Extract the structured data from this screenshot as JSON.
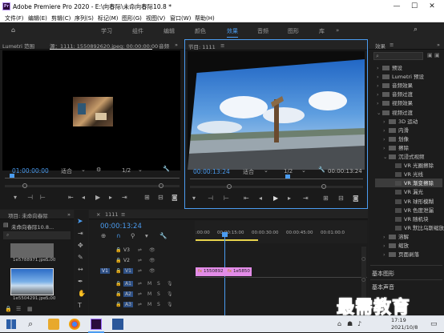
{
  "window": {
    "title": "Adobe Premiere Pro 2020 - E:\\向春际\\未命向春际10.8 *",
    "app_badge": "Pr",
    "minimize": "—",
    "maximize": "☐",
    "close": "✕"
  },
  "menu": [
    "文件(F)",
    "编辑(E)",
    "剪辑(C)",
    "序列(S)",
    "标记(M)",
    "图形(G)",
    "视图(V)",
    "窗口(W)",
    "帮助(H)"
  ],
  "workspaces": [
    "学习",
    "组件",
    "编辑",
    "颜色",
    "效果",
    "音频",
    "图形",
    "库"
  ],
  "active_workspace": "效果",
  "workspaces_more": "»",
  "source_monitor": {
    "tab_lumetri": "Lumetri 范围",
    "tab_source": "源：1111: 1550892620.jpeg: 00:00:00:00",
    "tab_audio": "音频",
    "more": "»",
    "timecode": "01:00:00:00",
    "fit": "适合",
    "resolution": "1/2"
  },
  "program_monitor": {
    "tab": "节目: 1111",
    "menu_icon": "≡",
    "timecode": "00:00:13:24",
    "fit": "适合",
    "resolution": "1/2",
    "duration": "00:00:13:24"
  },
  "effects_panel": {
    "tab": "效果",
    "menu_icon": "≡",
    "more": "»",
    "items": [
      {
        "label": "预设",
        "level": 0,
        "arrow": "›"
      },
      {
        "label": "Lumetri 预设",
        "level": 0,
        "arrow": "›"
      },
      {
        "label": "音频效果",
        "level": 0,
        "arrow": "›"
      },
      {
        "label": "音频过渡",
        "level": 0,
        "arrow": "›"
      },
      {
        "label": "视频效果",
        "level": 0,
        "arrow": "›"
      },
      {
        "label": "视频过渡",
        "level": 0,
        "arrow": "⌄"
      },
      {
        "label": "3D 运动",
        "level": 1,
        "arrow": "›"
      },
      {
        "label": "内滑",
        "level": 1,
        "arrow": "›"
      },
      {
        "label": "划像",
        "level": 1,
        "arrow": "›"
      },
      {
        "label": "擦除",
        "level": 1,
        "arrow": "›"
      },
      {
        "label": "沉浸式视频",
        "level": 1,
        "arrow": "⌄"
      },
      {
        "label": "VR 光圈擦除",
        "level": 2,
        "arrow": ""
      },
      {
        "label": "VR 光线",
        "level": 2,
        "arrow": ""
      },
      {
        "label": "VR 渐变擦除",
        "level": 2,
        "arrow": "",
        "selected": true
      },
      {
        "label": "VR 漏光",
        "level": 2,
        "arrow": ""
      },
      {
        "label": "VR 球形模糊",
        "level": 2,
        "arrow": ""
      },
      {
        "label": "VR 色度泄漏",
        "level": 2,
        "arrow": ""
      },
      {
        "label": "VR 随机块",
        "level": 2,
        "arrow": ""
      },
      {
        "label": "VR 默比乌斯缩放",
        "level": 2,
        "arrow": ""
      },
      {
        "label": "溶解",
        "level": 1,
        "arrow": "›"
      },
      {
        "label": "缩放",
        "level": 1,
        "arrow": "›"
      },
      {
        "label": "页面剥落",
        "level": 1,
        "arrow": "›"
      }
    ]
  },
  "basic_graphics": "基本图形",
  "basic_sound": "基本声音",
  "project_panel": {
    "tab": "项目: 未命向春际",
    "more": "»",
    "item_name": "未命向春际10.8...",
    "clips": [
      {
        "name": "1e5788971.jpe...",
        "duration": "5:00"
      },
      {
        "name": "1e5504291.jpe...",
        "duration": "5:00"
      }
    ]
  },
  "timeline": {
    "tab": "1111",
    "close": "×",
    "menu_icon": "≡",
    "timecode": "00:00:13:24",
    "ruler": [
      ":00:00",
      "00:00:15:00",
      "00:00:30:00",
      "00:00:45:00",
      "00:01:00:0"
    ],
    "tracks": [
      {
        "label": "V3",
        "src": ""
      },
      {
        "label": "V2",
        "src": ""
      },
      {
        "label": "V1",
        "src": "V1"
      },
      {
        "label": "A1",
        "src": ""
      },
      {
        "label": "A2",
        "src": ""
      },
      {
        "label": "A3",
        "src": ""
      }
    ],
    "clips": [
      {
        "name": "1550892"
      },
      {
        "name": "1e5850"
      }
    ],
    "lock": "🔒",
    "sync": "⇌",
    "eye": "👁",
    "mute": "M",
    "solo": "S",
    "mic": "🎙"
  },
  "taskbar": {
    "time": "17:19",
    "date": "2021/10/8"
  },
  "watermark": "最需教育",
  "colors": {
    "accent": "#4b9cf0",
    "clip": "#e38ce8",
    "workarea": "#e8d44d"
  }
}
